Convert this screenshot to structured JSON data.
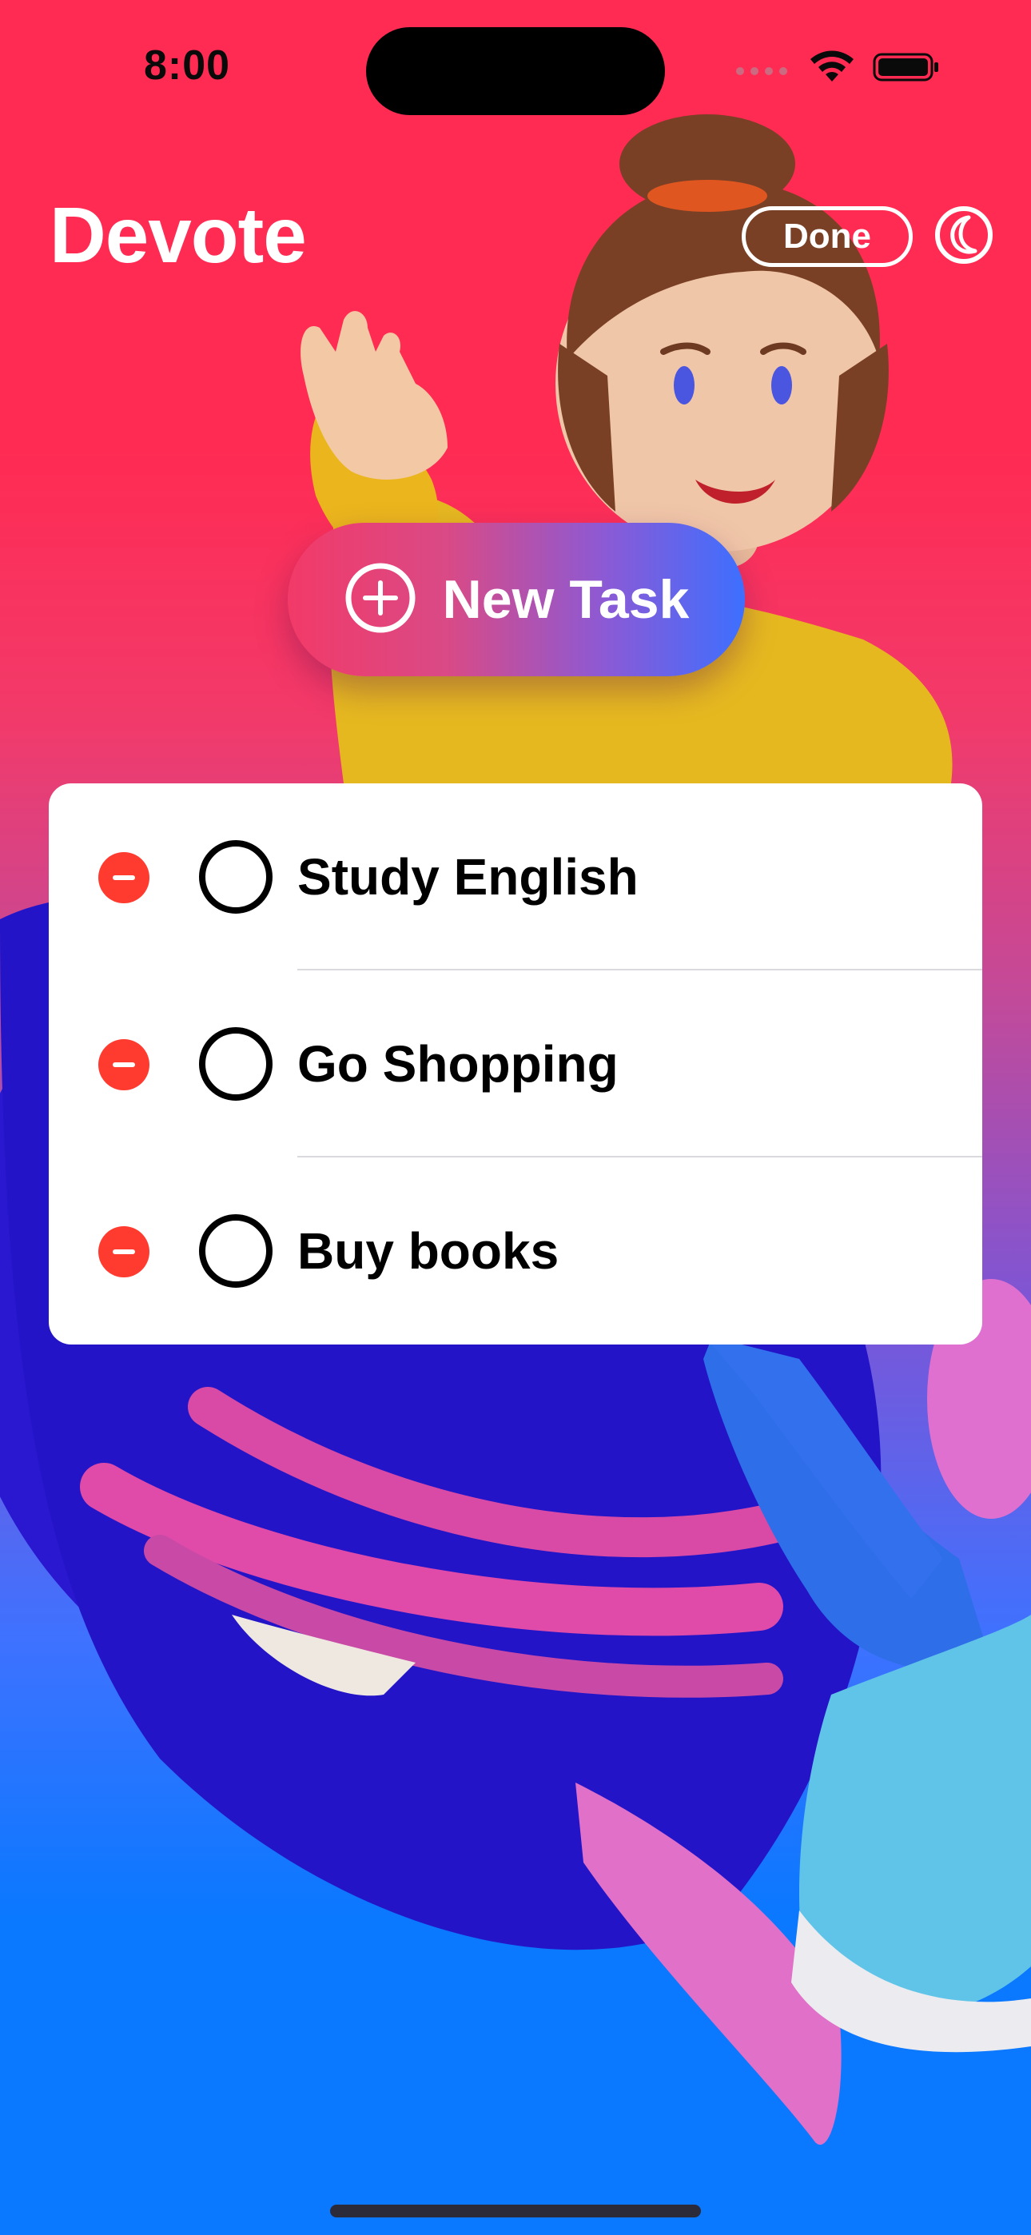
{
  "status_bar": {
    "time": "8:00"
  },
  "header": {
    "title": "Devote",
    "done_label": "Done",
    "theme_icon": "moon-icon"
  },
  "new_task": {
    "label": "New Task",
    "icon": "plus-circle-icon"
  },
  "tasks": [
    {
      "title": "Study English",
      "completed": false
    },
    {
      "title": "Go Shopping",
      "completed": false
    },
    {
      "title": "Buy books",
      "completed": false
    }
  ],
  "colors": {
    "background_top": "#ff2b53",
    "background_bottom": "#0a78ff",
    "delete_red": "#ff3b30",
    "text_primary": "#000000",
    "header_text": "#ffffff"
  }
}
